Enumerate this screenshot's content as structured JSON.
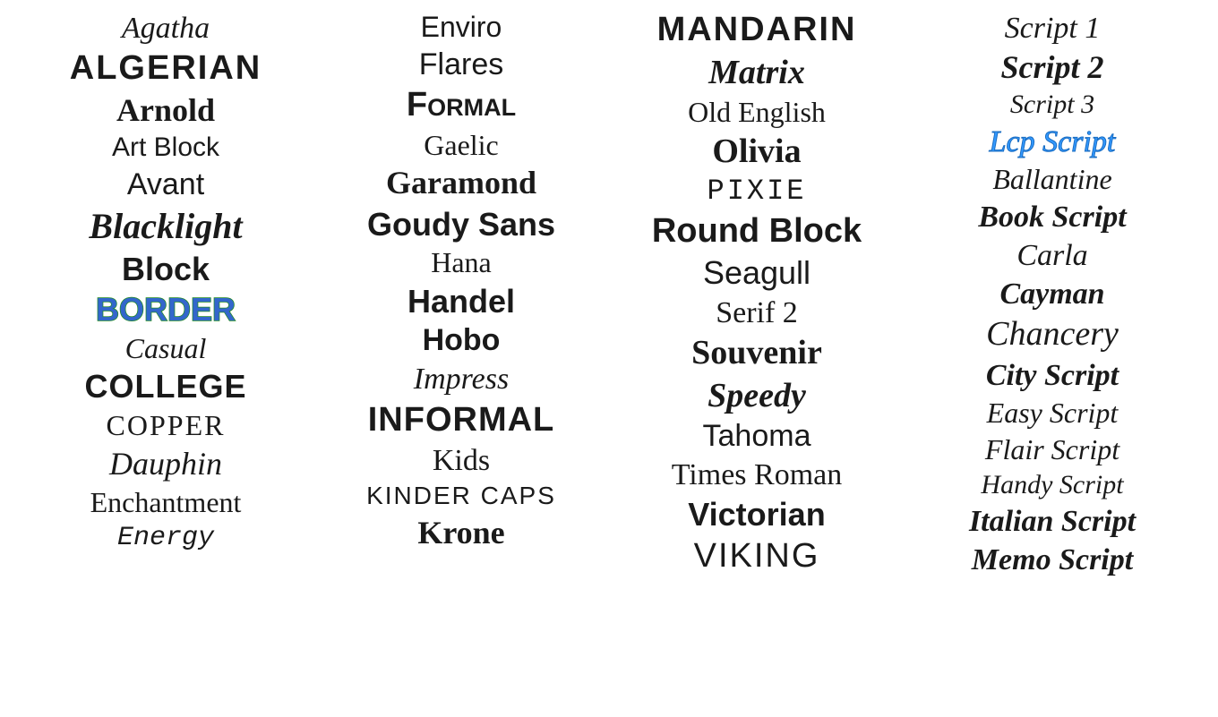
{
  "columns": [
    {
      "id": "col1",
      "items": [
        {
          "label": "Agatha",
          "cssClass": "f-agatha"
        },
        {
          "label": "ALGERIAN",
          "cssClass": "f-algerian"
        },
        {
          "label": "Arnold",
          "cssClass": "f-arnold"
        },
        {
          "label": "Art Block",
          "cssClass": "f-artblock"
        },
        {
          "label": "Avant",
          "cssClass": "f-avant"
        },
        {
          "label": "Blacklight",
          "cssClass": "f-blacklight"
        },
        {
          "label": "Block",
          "cssClass": "f-block"
        },
        {
          "label": "BORDER",
          "cssClass": "f-border border-text"
        },
        {
          "label": "Casual",
          "cssClass": "f-casual"
        },
        {
          "label": "COLLEGE",
          "cssClass": "f-college"
        },
        {
          "label": "COPPER",
          "cssClass": "f-copper"
        },
        {
          "label": "Dauphin",
          "cssClass": "f-dauphin"
        },
        {
          "label": "Enchantment",
          "cssClass": "f-enchantment"
        },
        {
          "label": "Energy",
          "cssClass": "f-energy"
        }
      ]
    },
    {
      "id": "col2",
      "items": [
        {
          "label": "Enviro",
          "cssClass": "f-enviro"
        },
        {
          "label": "Flares",
          "cssClass": "f-flares"
        },
        {
          "label": "Formal",
          "cssClass": "f-formal"
        },
        {
          "label": "Gaelic",
          "cssClass": "f-gaelic"
        },
        {
          "label": "Garamond",
          "cssClass": "f-garamond"
        },
        {
          "label": "Goudy Sans",
          "cssClass": "f-goudy"
        },
        {
          "label": "Hana",
          "cssClass": "f-hana"
        },
        {
          "label": "Handel",
          "cssClass": "f-handel"
        },
        {
          "label": "Hobo",
          "cssClass": "f-hobo"
        },
        {
          "label": "Impress",
          "cssClass": "f-impress"
        },
        {
          "label": "INFORMAL",
          "cssClass": "f-informal"
        },
        {
          "label": "Kids",
          "cssClass": "f-kids"
        },
        {
          "label": "KINDER CAPS",
          "cssClass": "f-kindercaps"
        },
        {
          "label": "Krone",
          "cssClass": "f-krone"
        }
      ]
    },
    {
      "id": "col3",
      "items": [
        {
          "label": "MANDARIN",
          "cssClass": "f-mandarin"
        },
        {
          "label": "Matrix",
          "cssClass": "f-matrix"
        },
        {
          "label": "Old English",
          "cssClass": "f-oldenglish"
        },
        {
          "label": "Olivia",
          "cssClass": "f-olivia"
        },
        {
          "label": "PIXIE",
          "cssClass": "f-pixie"
        },
        {
          "label": "Round Block",
          "cssClass": "f-roundblock"
        },
        {
          "label": "Seagull",
          "cssClass": "f-seagull"
        },
        {
          "label": "Serif 2",
          "cssClass": "f-serif2"
        },
        {
          "label": "Souvenir",
          "cssClass": "f-souvenir"
        },
        {
          "label": "Speedy",
          "cssClass": "f-speedy"
        },
        {
          "label": "Tahoma",
          "cssClass": "f-tahoma"
        },
        {
          "label": "Times Roman",
          "cssClass": "f-timesroman"
        },
        {
          "label": "Victorian",
          "cssClass": "f-victorian"
        },
        {
          "label": "VIKING",
          "cssClass": "f-viking"
        }
      ]
    },
    {
      "id": "col4",
      "items": [
        {
          "label": "Script 1",
          "cssClass": "f-script1"
        },
        {
          "label": "Script 2",
          "cssClass": "f-script2"
        },
        {
          "label": "Script 3",
          "cssClass": "f-script3"
        },
        {
          "label": "Lcp Script",
          "cssClass": "f-lcpscript lcp-text"
        },
        {
          "label": "Ballantine",
          "cssClass": "f-ballantine"
        },
        {
          "label": "Book Script",
          "cssClass": "f-bookscript"
        },
        {
          "label": "Carla",
          "cssClass": "f-carla"
        },
        {
          "label": "Cayman",
          "cssClass": "f-cayman"
        },
        {
          "label": "Chancery",
          "cssClass": "f-chancery"
        },
        {
          "label": "City Script",
          "cssClass": "f-cityscript"
        },
        {
          "label": "Easy Script",
          "cssClass": "f-easyscript"
        },
        {
          "label": "Flair Script",
          "cssClass": "f-flairscript"
        },
        {
          "label": "Handy Script",
          "cssClass": "f-handyscript"
        },
        {
          "label": "Italian Script",
          "cssClass": "f-italianscript"
        },
        {
          "label": "Memo Script",
          "cssClass": "f-memoscript"
        }
      ]
    }
  ]
}
